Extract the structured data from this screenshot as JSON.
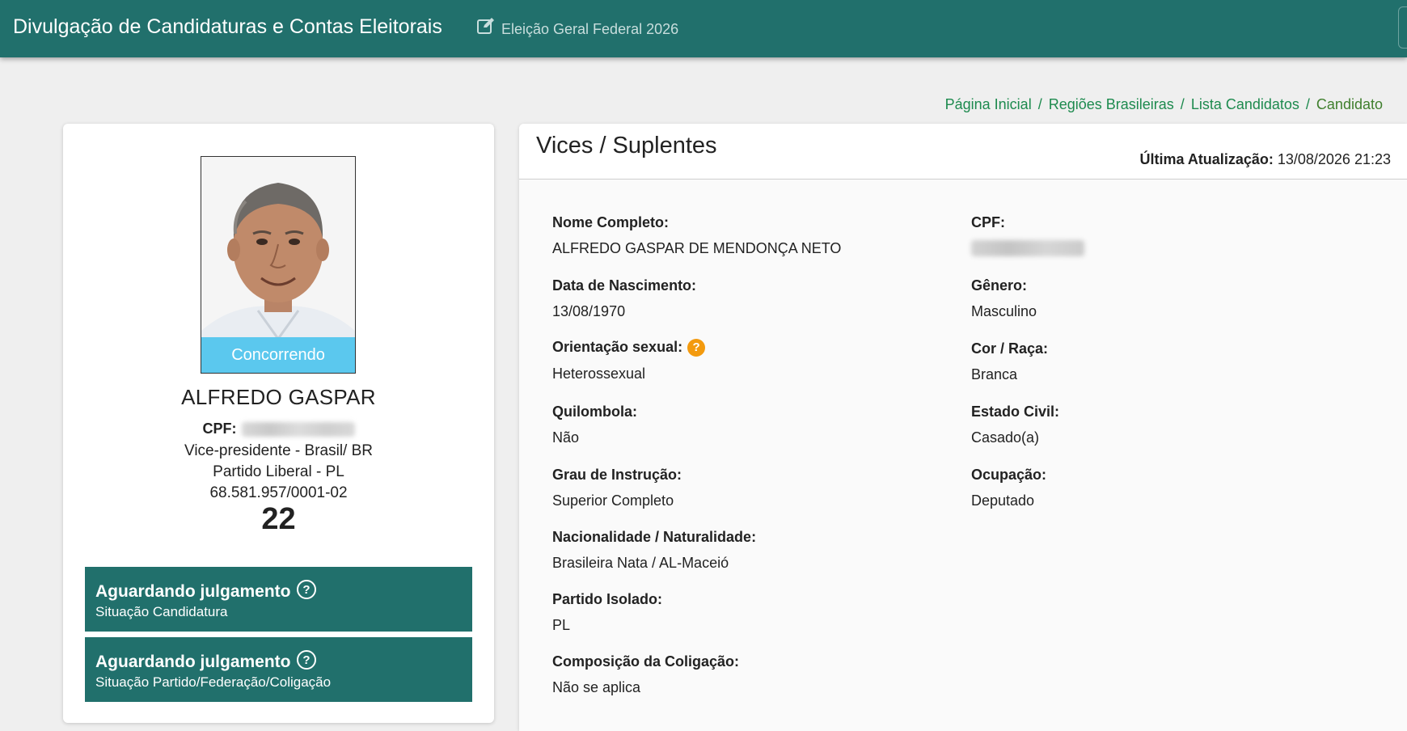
{
  "header": {
    "title": "Divulgação de Candidaturas e Contas Eleitorais",
    "election": "Eleição Geral Federal 2026",
    "edit_icon": "edit-icon"
  },
  "breadcrumb": {
    "items": [
      "Página Inicial",
      "Regiões Brasileiras",
      "Lista Candidatos"
    ],
    "current": "Candidato",
    "separator": "/"
  },
  "candidate": {
    "status_ribbon": "Concorrendo",
    "name": "ALFREDO GASPAR",
    "cpf_label": "CPF:",
    "role": "Vice-presidente - Brasil/ BR",
    "party": "Partido Liberal - PL",
    "cnpj": "68.581.957/0001-02",
    "number": "22"
  },
  "situations": [
    {
      "title": "Aguardando julgamento",
      "subtitle": "Situação Candidatura"
    },
    {
      "title": "Aguardando julgamento",
      "subtitle": "Situação Partido/Federação/Coligação"
    }
  ],
  "panel": {
    "title": "Vices / Suplentes",
    "updated_label": "Última Atualização:",
    "updated_value": "13/08/2026 21:23"
  },
  "fields_left": [
    {
      "label": "Nome Completo:",
      "value": "ALFREDO GASPAR DE MENDONÇA NETO"
    },
    {
      "label": "Data de Nascimento:",
      "value": "13/08/1970"
    },
    {
      "label": "Orientação sexual:",
      "value": "Heterossexual",
      "help": "?"
    },
    {
      "label": "Quilombola:",
      "value": "Não"
    },
    {
      "label": "Grau de Instrução:",
      "value": "Superior Completo"
    },
    {
      "label": "Nacionalidade / Naturalidade:",
      "value": "Brasileira Nata / AL-Maceió"
    },
    {
      "label": "Partido Isolado:",
      "value": "PL"
    },
    {
      "label": "Composição da Coligação:",
      "value": "Não se aplica"
    }
  ],
  "fields_right": [
    {
      "label": "CPF:",
      "value": ""
    },
    {
      "label": "Gênero:",
      "value": "Masculino"
    },
    {
      "label": "Cor / Raça:",
      "value": "Branca"
    },
    {
      "label": "Estado Civil:",
      "value": "Casado(a)"
    },
    {
      "label": "Ocupação:",
      "value": "Deputado"
    }
  ],
  "colors": {
    "header_bg": "#21706c",
    "ribbon": "#5bc8ee",
    "breadcrumb_link": "#1d8a4e",
    "help_badge": "#f39a0e"
  }
}
